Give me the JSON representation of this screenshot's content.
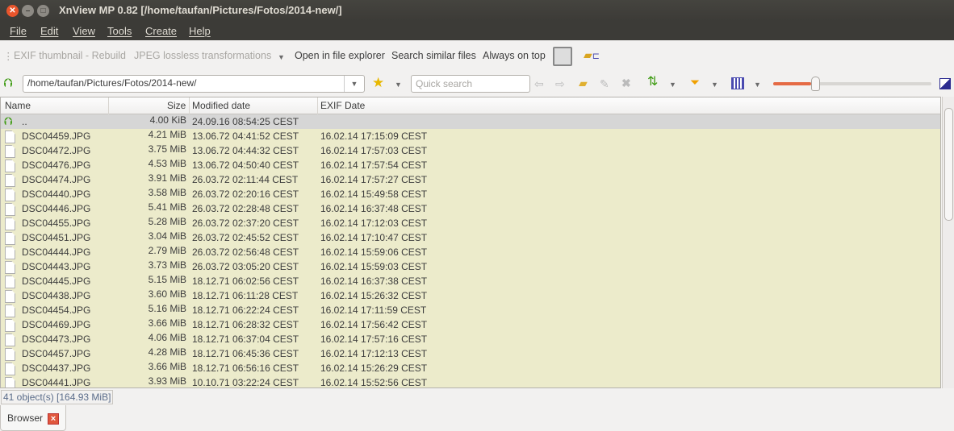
{
  "window": {
    "title": "XnView MP 0.82 [/home/taufan/Pictures/Fotos/2014-new/]"
  },
  "menu": [
    "File",
    "Edit",
    "View",
    "Tools",
    "Create",
    "Help"
  ],
  "toolbar": {
    "exif_rebuild": "EXIF thumbnail - Rebuild",
    "jpeg_lossless": "JPEG lossless transformations",
    "open_explorer": "Open in file explorer",
    "search_similar": "Search similar files",
    "always_on_top": "Always on top"
  },
  "address": {
    "path": "/home/taufan/Pictures/Fotos/2014-new/",
    "search_placeholder": "Quick search"
  },
  "thumb_size_slider": 0.24,
  "columns": [
    "Name",
    "Size",
    "Modified date",
    "EXIF Date"
  ],
  "parent_row": {
    "name": "..",
    "size": "4.00 KiB",
    "modified": "24.09.16 08:54:25 CEST",
    "exif": ""
  },
  "files": [
    {
      "name": "DSC04459.JPG",
      "size": "4.21 MiB",
      "modified": "13.06.72 04:41:52 CEST",
      "exif": "16.02.14 17:15:09 CEST"
    },
    {
      "name": "DSC04472.JPG",
      "size": "3.75 MiB",
      "modified": "13.06.72 04:44:32 CEST",
      "exif": "16.02.14 17:57:03 CEST"
    },
    {
      "name": "DSC04476.JPG",
      "size": "4.53 MiB",
      "modified": "13.06.72 04:50:40 CEST",
      "exif": "16.02.14 17:57:54 CEST"
    },
    {
      "name": "DSC04474.JPG",
      "size": "3.91 MiB",
      "modified": "26.03.72 02:11:44 CEST",
      "exif": "16.02.14 17:57:27 CEST"
    },
    {
      "name": "DSC04440.JPG",
      "size": "3.58 MiB",
      "modified": "26.03.72 02:20:16 CEST",
      "exif": "16.02.14 15:49:58 CEST"
    },
    {
      "name": "DSC04446.JPG",
      "size": "5.41 MiB",
      "modified": "26.03.72 02:28:48 CEST",
      "exif": "16.02.14 16:37:48 CEST"
    },
    {
      "name": "DSC04455.JPG",
      "size": "5.28 MiB",
      "modified": "26.03.72 02:37:20 CEST",
      "exif": "16.02.14 17:12:03 CEST"
    },
    {
      "name": "DSC04451.JPG",
      "size": "3.04 MiB",
      "modified": "26.03.72 02:45:52 CEST",
      "exif": "16.02.14 17:10:47 CEST"
    },
    {
      "name": "DSC04444.JPG",
      "size": "2.79 MiB",
      "modified": "26.03.72 02:56:48 CEST",
      "exif": "16.02.14 15:59:06 CEST"
    },
    {
      "name": "DSC04443.JPG",
      "size": "3.73 MiB",
      "modified": "26.03.72 03:05:20 CEST",
      "exif": "16.02.14 15:59:03 CEST"
    },
    {
      "name": "DSC04445.JPG",
      "size": "5.15 MiB",
      "modified": "18.12.71 06:02:56 CEST",
      "exif": "16.02.14 16:37:38 CEST"
    },
    {
      "name": "DSC04438.JPG",
      "size": "3.60 MiB",
      "modified": "18.12.71 06:11:28 CEST",
      "exif": "16.02.14 15:26:32 CEST"
    },
    {
      "name": "DSC04454.JPG",
      "size": "5.16 MiB",
      "modified": "18.12.71 06:22:24 CEST",
      "exif": "16.02.14 17:11:59 CEST"
    },
    {
      "name": "DSC04469.JPG",
      "size": "3.66 MiB",
      "modified": "18.12.71 06:28:32 CEST",
      "exif": "16.02.14 17:56:42 CEST"
    },
    {
      "name": "DSC04473.JPG",
      "size": "4.06 MiB",
      "modified": "18.12.71 06:37:04 CEST",
      "exif": "16.02.14 17:57:16 CEST"
    },
    {
      "name": "DSC04457.JPG",
      "size": "4.28 MiB",
      "modified": "18.12.71 06:45:36 CEST",
      "exif": "16.02.14 17:12:13 CEST"
    },
    {
      "name": "DSC04437.JPG",
      "size": "3.66 MiB",
      "modified": "18.12.71 06:56:16 CEST",
      "exif": "16.02.14 15:26:29 CEST"
    },
    {
      "name": "DSC04441.JPG",
      "size": "3.93 MiB",
      "modified": "10.10.71 03:22:24 CEST",
      "exif": "16.02.14 15:52:56 CEST"
    }
  ],
  "status": "41 object(s) [164.93 MiB]",
  "tabs": [
    {
      "label": "Browser"
    }
  ],
  "colors": {
    "row_bg": "#ecebcb",
    "accent": "#e56a44"
  }
}
